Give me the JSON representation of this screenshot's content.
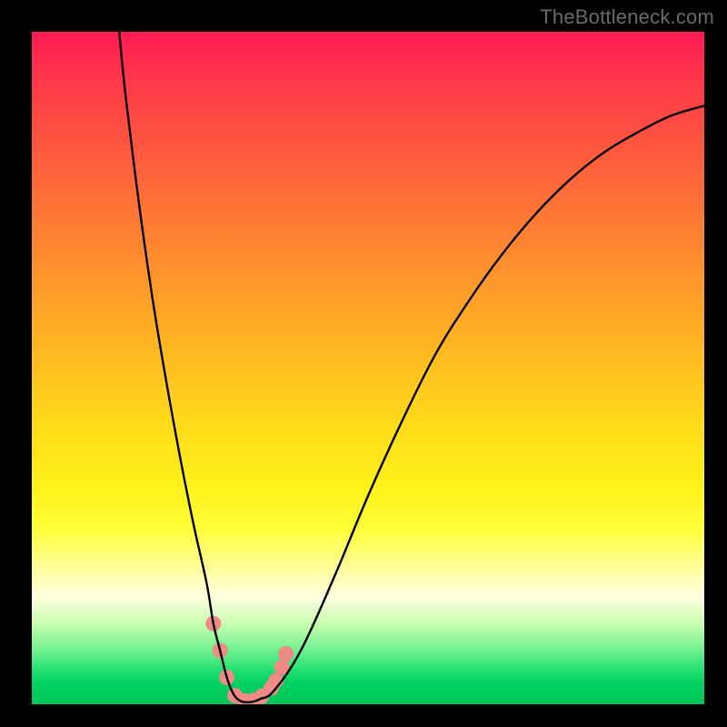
{
  "watermark": "TheBottleneck.com",
  "chart_data": {
    "type": "line",
    "title": "",
    "xlabel": "",
    "ylabel": "",
    "xlim": [
      0,
      100
    ],
    "ylim": [
      0,
      100
    ],
    "background_gradient": {
      "top": "#ff1a52",
      "middle": "#ffe020",
      "bottom": "#00c858"
    },
    "series": [
      {
        "name": "curve",
        "color": "#000000",
        "x": [
          13,
          14,
          16,
          18,
          20,
          22,
          24,
          26,
          27,
          28,
          29,
          30,
          31,
          32,
          33,
          34,
          36,
          40,
          45,
          50,
          55,
          60,
          65,
          70,
          75,
          80,
          85,
          90,
          95,
          100
        ],
        "y": [
          100,
          90,
          74,
          60,
          48,
          37,
          27,
          18,
          12,
          8,
          4,
          1.5,
          0.5,
          0.3,
          0.4,
          0.8,
          2,
          8,
          19,
          31,
          42,
          52,
          60,
          67,
          73,
          78,
          82,
          85,
          87.5,
          89
        ]
      }
    ],
    "markers": [
      {
        "name": "notch-peaks",
        "color": "#ef8a84",
        "points": [
          {
            "x": 27.0,
            "y": 12
          },
          {
            "x": 28.0,
            "y": 8
          },
          {
            "x": 29.0,
            "y": 4
          },
          {
            "x": 30.2,
            "y": 1.3
          },
          {
            "x": 31.6,
            "y": 0.5
          },
          {
            "x": 33.0,
            "y": 0.6
          },
          {
            "x": 34.2,
            "y": 1.2
          },
          {
            "x": 35.6,
            "y": 2.4
          },
          {
            "x": 36.3,
            "y": 3.5
          },
          {
            "x": 37.2,
            "y": 5.5
          },
          {
            "x": 37.8,
            "y": 7.5
          }
        ]
      }
    ]
  }
}
